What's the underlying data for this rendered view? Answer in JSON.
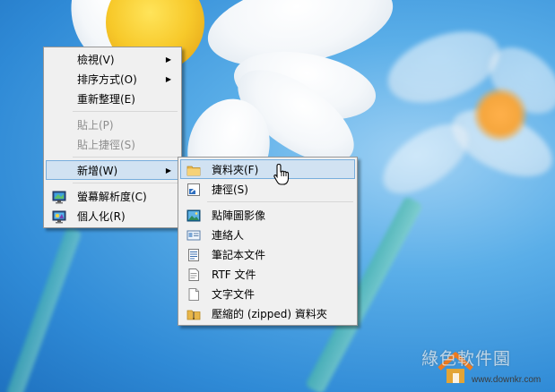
{
  "main_menu": {
    "items": [
      {
        "label": "檢視(V)",
        "submenu": true,
        "disabled": false
      },
      {
        "label": "排序方式(O)",
        "submenu": true,
        "disabled": false
      },
      {
        "label": "重新整理(E)",
        "submenu": false,
        "disabled": false
      },
      {
        "label": "貼上(P)",
        "submenu": false,
        "disabled": true
      },
      {
        "label": "貼上捷徑(S)",
        "submenu": false,
        "disabled": true
      },
      {
        "label": "新增(W)",
        "submenu": true,
        "disabled": false,
        "highlighted": true
      },
      {
        "label": "螢幕解析度(C)",
        "submenu": false,
        "disabled": false,
        "icon": "monitor-icon"
      },
      {
        "label": "個人化(R)",
        "submenu": false,
        "disabled": false,
        "icon": "personalize-monitor-icon"
      }
    ]
  },
  "new_submenu": {
    "items": [
      {
        "label": "資料夾(F)",
        "icon": "folder-icon",
        "highlighted": true
      },
      {
        "label": "捷徑(S)",
        "icon": "shortcut-icon"
      },
      {
        "label": "點陣圖影像",
        "icon": "bitmap-image-icon"
      },
      {
        "label": "連絡人",
        "icon": "contact-card-icon"
      },
      {
        "label": "筆記本文件",
        "icon": "notepad-document-icon"
      },
      {
        "label": "RTF 文件",
        "icon": "rtf-document-icon"
      },
      {
        "label": "文字文件",
        "icon": "text-document-icon"
      },
      {
        "label": "壓縮的 (zipped) 資料夾",
        "icon": "zip-folder-icon"
      }
    ]
  },
  "watermark": {
    "text": "綠色軟件園",
    "url": "www.downkr.com"
  },
  "colors": {
    "menu_bg": "#f0f0f0",
    "highlight_bg": "#d1e2f2",
    "highlight_border": "#78aedd",
    "disabled_text": "#8d8d8d"
  }
}
